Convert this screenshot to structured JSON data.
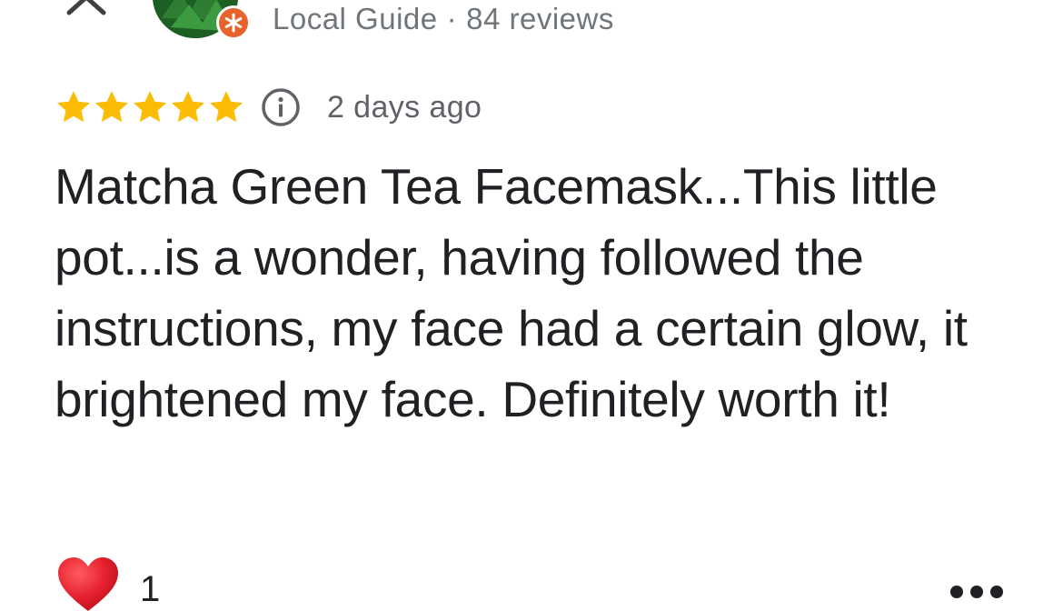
{
  "author": {
    "level": "Local Guide",
    "separator": "·",
    "review_count": "84 reviews"
  },
  "review": {
    "rating": 5,
    "rating_max": 5,
    "date": "2 days ago",
    "text": "Matcha Green Tea Facemask...This little pot...is a wonder, having followed the instructions, my face had a certain glow, it brightened my face. Definitely worth it!"
  },
  "reactions": {
    "heart_count": "1"
  },
  "icons": {
    "close": "close-icon",
    "avatar": "avatar",
    "guide_badge": "local-guide-star-icon",
    "star": "star-icon",
    "info": "info-icon",
    "heart": "heart-icon",
    "more": "more-options-icon"
  },
  "colors": {
    "star": "#fbbc04",
    "badge": "#e8632b",
    "heart": "#e5202e",
    "secondary_text": "#70757a",
    "primary_text": "#202124"
  }
}
